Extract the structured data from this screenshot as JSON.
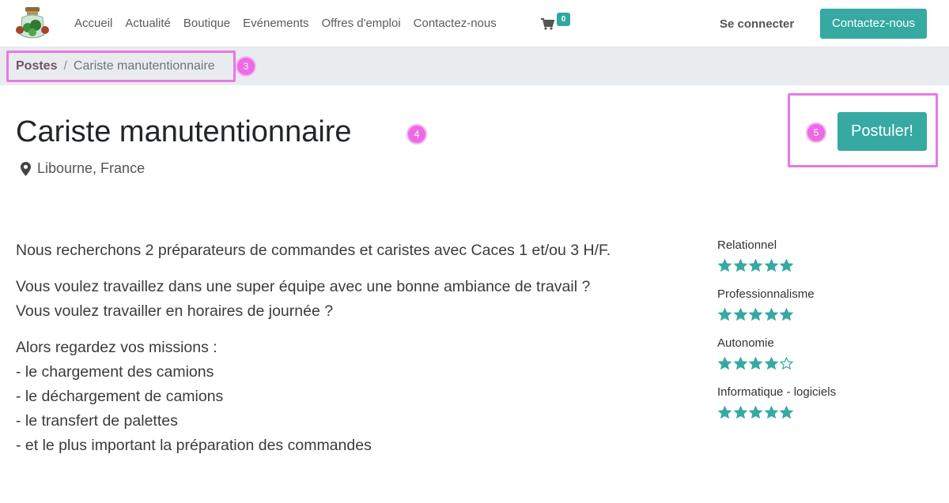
{
  "navbar": {
    "links": [
      "Accueil",
      "Actualité",
      "Boutique",
      "Evénements",
      "Offres d'emploi",
      "Contactez-nous"
    ],
    "cart_count": "0",
    "signin_label": "Se connecter",
    "contact_button": "Contactez-nous",
    "accent_color": "#35a9a2"
  },
  "breadcrumb": {
    "parent": "Postes",
    "separator": "/",
    "current": "Cariste manutentionnaire"
  },
  "markers": {
    "breadcrumb": "3",
    "title": "4",
    "apply": "5"
  },
  "job": {
    "title": "Cariste manutentionnaire",
    "location": "Libourne, France",
    "apply_label": "Postuler!",
    "location_icon": "map-marker-icon"
  },
  "description": {
    "p1": "Nous recherchons 2 préparateurs de commandes et caristes avec Caces 1 et/ou 3 H/F.",
    "p2_line1": "Vous voulez travaillez dans une super équipe avec une bonne ambiance de travail ?",
    "p2_line2": "Vous voulez travailler en horaires de journée ?",
    "p3_lines": [
      "Alors regardez vos missions :",
      "- le chargement des camions",
      "- le déchargement de camions",
      "- le transfert de palettes",
      "- et le plus important la préparation des commandes"
    ]
  },
  "skills": [
    {
      "name": "Relationnel",
      "rating": 5,
      "max": 5
    },
    {
      "name": "Professionnalisme",
      "rating": 5,
      "max": 5
    },
    {
      "name": "Autonomie",
      "rating": 4,
      "max": 5
    },
    {
      "name": "Informatique - logiciels",
      "rating": 5,
      "max": 5
    }
  ]
}
